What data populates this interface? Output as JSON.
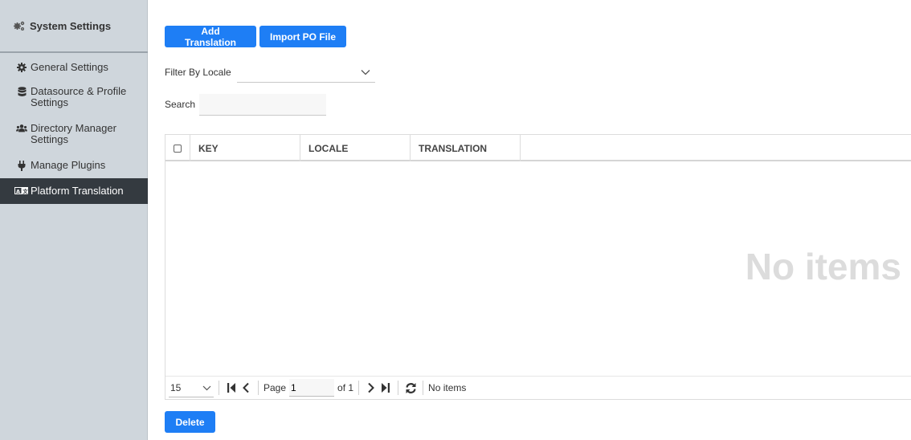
{
  "sidebar": {
    "title": "System Settings",
    "title_icon": "gears-icon",
    "items": [
      {
        "label": "General Settings",
        "icon": "gear-icon"
      },
      {
        "label": "Datasource & Profile Settings",
        "icon": "database-icon"
      },
      {
        "label": "Directory Manager Settings",
        "icon": "users-icon"
      },
      {
        "label": "Manage Plugins",
        "icon": "plug-icon"
      },
      {
        "label": "Platform Translation",
        "icon": "language-icon",
        "active": true
      }
    ]
  },
  "toolbar": {
    "add_label": "Add Translation",
    "import_label": "Import PO File"
  },
  "filters": {
    "locale_label": "Filter By Locale",
    "locale_value": "",
    "search_label": "Search",
    "search_value": ""
  },
  "grid": {
    "columns": [
      "KEY",
      "LOCALE",
      "TRANSLATION"
    ],
    "empty_message": "No items",
    "pager": {
      "page_size": "15",
      "page_label": "Page",
      "page_value": "1",
      "of_label": "of 1",
      "status": "No items"
    }
  },
  "footer": {
    "delete_label": "Delete"
  },
  "colors": {
    "primary": "#1e7ef5",
    "sidebar_bg": "#cfd6dc",
    "active_bg": "#343a40"
  }
}
